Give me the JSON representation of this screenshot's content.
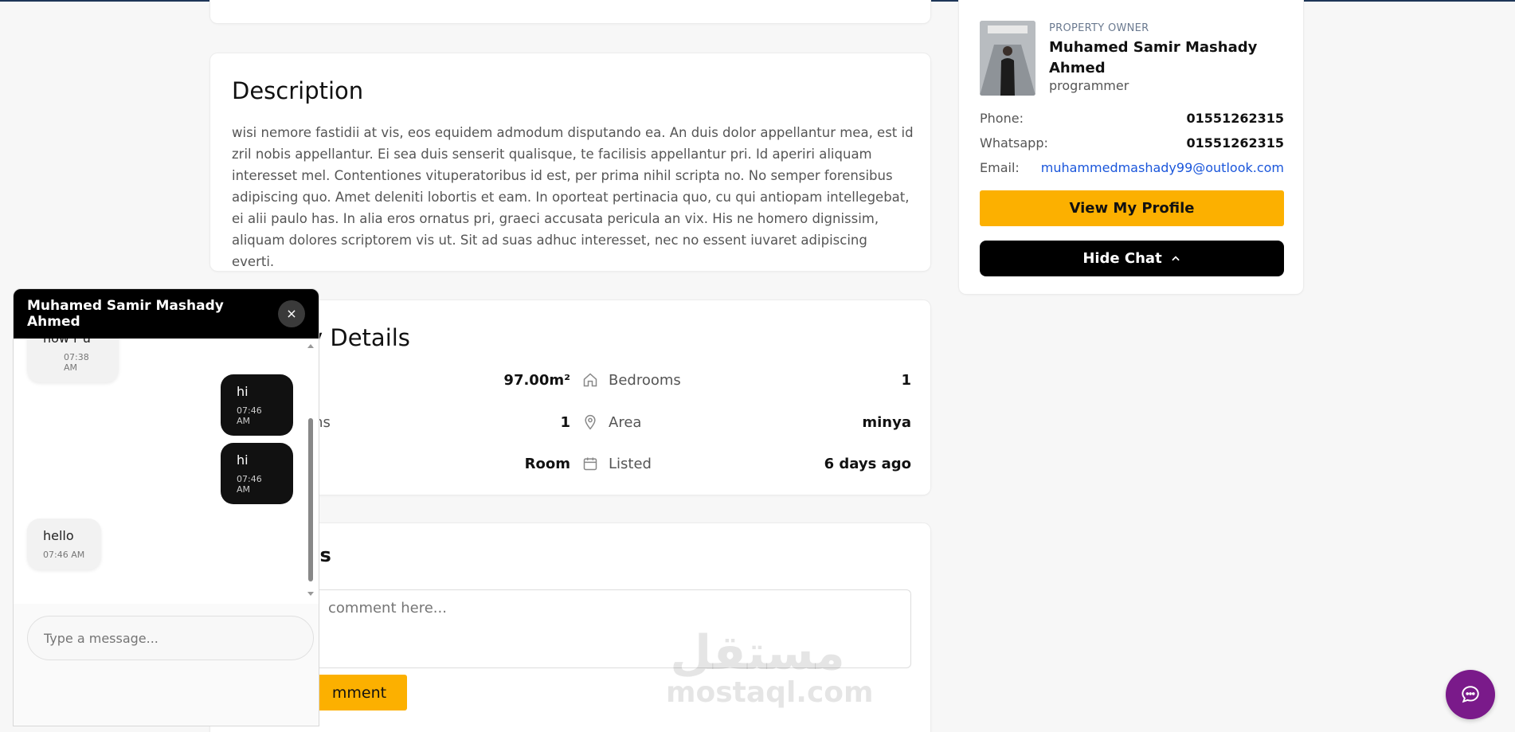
{
  "description": {
    "title": "Description",
    "text": "wisi nemore fastidii at vis, eos equidem admodum disputando ea. An duis dolor appellantur mea, est id zril nobis appellantur. Ei sea duis senserit qualisque, te facilisis appellantur pri. Id aperiri aliquam interesset mel. Contentiones vituperatoribus id est, per prima nihil scripta no. No semper forensibus adipiscing quo. Amet deleniti lobortis et eam. In oporteat pertinacia quo, cu qui antiopam intellegebat, ei alii paulo has. In alia eros ornatus pri, graeci accusata pericula an vix. His ne homero dignissim, aliquam dolores scriptorem vis ut. Sit ad suas adhuc interesset, nec no essent iuvaret adipiscing everti."
  },
  "details": {
    "title": "y Details",
    "left": [
      {
        "label": "",
        "value": "97.00m²"
      },
      {
        "label": "ms",
        "value": "1"
      },
      {
        "label": "",
        "value": "Room"
      }
    ],
    "right": [
      {
        "label": "Bedrooms",
        "value": "1",
        "icon": "home-icon"
      },
      {
        "label": "Area",
        "value": "minya",
        "icon": "map-pin-icon"
      },
      {
        "label": "Listed",
        "value": "6 days ago",
        "icon": "calendar-icon"
      }
    ]
  },
  "comments": {
    "title": "ts",
    "placeholder": "comment here...",
    "button": "mment"
  },
  "owner": {
    "tag": "PROPERTY OWNER",
    "name": "Muhamed Samir Mashady Ahmed",
    "role": "programmer",
    "phone_label": "Phone:",
    "phone": "01551262315",
    "whatsapp_label": "Whatsapp:",
    "whatsapp": "01551262315",
    "email_label": "Email:",
    "email": "muhammedmashady99@outlook.com",
    "profile_button": "View My Profile",
    "chat_button": "Hide Chat"
  },
  "chat": {
    "title": "Muhamed Samir Mashady Ahmed",
    "messages": [
      {
        "direction": "in",
        "text": "how r u",
        "time": "07:38 AM"
      },
      {
        "direction": "out",
        "text": "hi",
        "time": "07:46 AM"
      },
      {
        "direction": "out",
        "text": "hi",
        "time": "07:46 AM"
      },
      {
        "direction": "in",
        "text": "hello",
        "time": "07:46 AM"
      }
    ],
    "input_placeholder": "Type a message..."
  },
  "watermark": {
    "arabic": "مستقل",
    "latin": "mostaql.com"
  },
  "colors": {
    "accent_yellow": "#fcb000",
    "black": "#000000",
    "fab_purple": "#7a1a8a",
    "link_blue": "#1a56db"
  }
}
